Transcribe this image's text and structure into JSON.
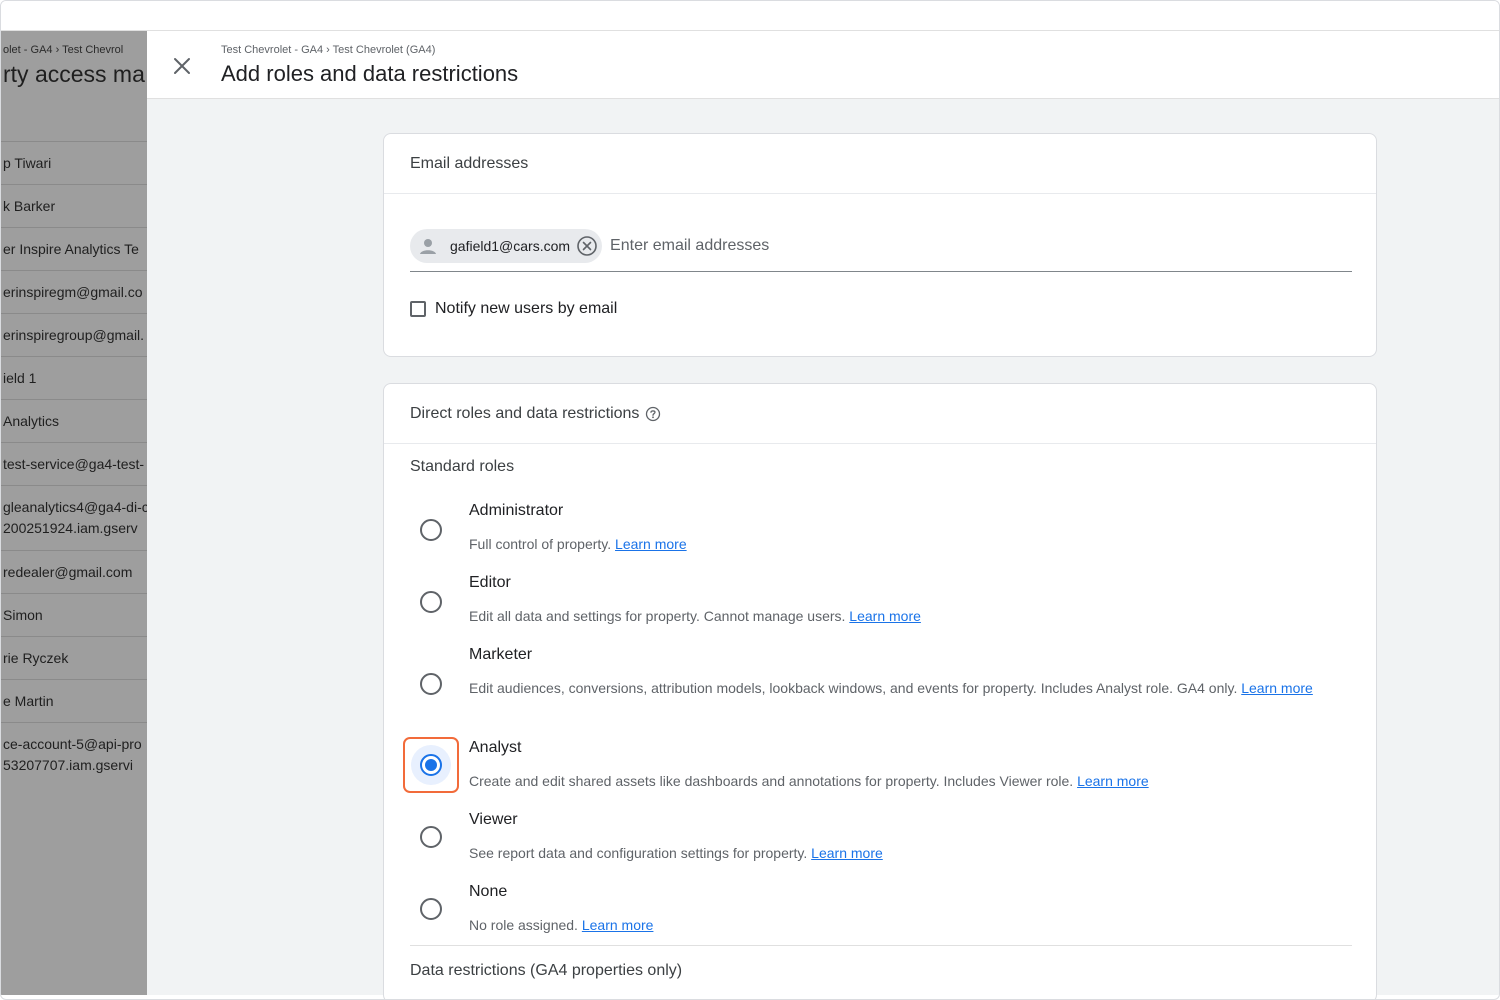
{
  "background": {
    "crumb": "olet - GA4 › Test Chevrol",
    "title": "rty access ma",
    "users": [
      {
        "line1": "p Tiwari"
      },
      {
        "line1": "k Barker"
      },
      {
        "line1": "er Inspire Analytics Te"
      },
      {
        "line1": "erinspiregm@gmail.co"
      },
      {
        "line1": "erinspiregroup@gmail."
      },
      {
        "line1": "ield 1"
      },
      {
        "line1": "Analytics"
      },
      {
        "line1": "test-service@ga4-test-"
      },
      {
        "line1": "gleanalytics4@ga4-di-c",
        "line2": "200251924.iam.gserv"
      },
      {
        "line1": "redealer@gmail.com"
      },
      {
        "line1": "Simon"
      },
      {
        "line1": "rie Ryczek"
      },
      {
        "line1": "e Martin"
      },
      {
        "line1": "ce-account-5@api-pro",
        "line2": "53207707.iam.gservi"
      }
    ]
  },
  "dialog": {
    "crumb": "Test Chevrolet - GA4 › Test Chevrolet (GA4)",
    "title": "Add roles and data restrictions",
    "close_icon": "close-icon"
  },
  "email_card": {
    "header": "Email addresses",
    "chip_email": "gafield1@cars.com",
    "input_placeholder": "Enter email addresses",
    "notify_label": "Notify new users by email"
  },
  "roles_card": {
    "header": "Direct roles and data restrictions",
    "standard_roles_label": "Standard roles",
    "learn_more": "Learn more",
    "roles": [
      {
        "name": "Administrator",
        "desc": "Full control of property.",
        "checked": false
      },
      {
        "name": "Editor",
        "desc": "Edit all data and settings for property. Cannot manage users.",
        "checked": false
      },
      {
        "name": "Marketer",
        "desc": "Edit audiences, conversions, attribution models, lookback windows, and events for property. Includes Analyst role. GA4 only.",
        "checked": false
      },
      {
        "name": "Analyst",
        "desc": "Create and edit shared assets like dashboards and annotations for property. Includes Viewer role.",
        "checked": true
      },
      {
        "name": "Viewer",
        "desc": "See report data and configuration settings for property.",
        "checked": false
      },
      {
        "name": "None",
        "desc": "No role assigned.",
        "checked": false
      }
    ],
    "data_restrictions_label": "Data restrictions (GA4 properties only)"
  },
  "colors": {
    "accent": "#1a73e8",
    "highlight": "#f26b3a"
  }
}
